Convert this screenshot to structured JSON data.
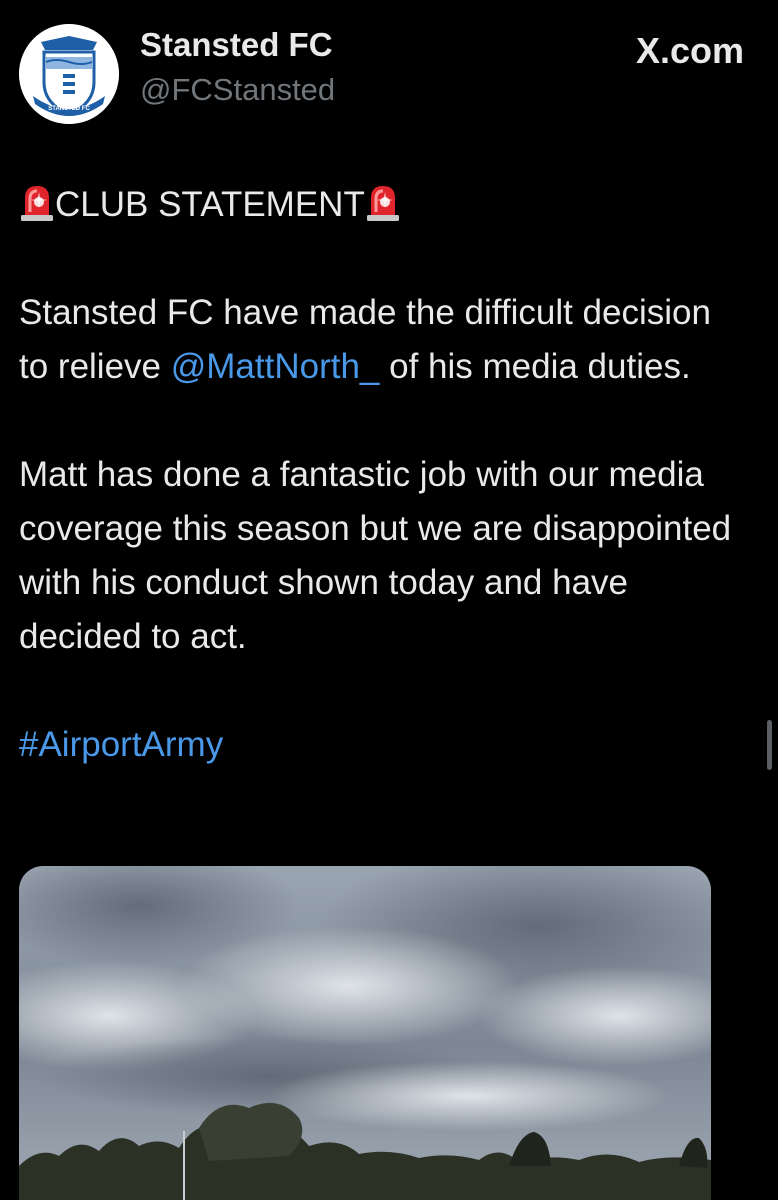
{
  "post": {
    "author": {
      "display_name": "Stansted FC",
      "handle": "@FCStansted",
      "avatar_text": "STANSTED FC"
    },
    "source_label": "X.com",
    "statement_heading": "CLUB STATEMENT",
    "paragraph1_before": "Stansted FC have made the difficult decision to relieve ",
    "mention": "@MattNorth_",
    "paragraph1_after": " of his media duties.",
    "paragraph2": "Matt has done a fantastic job with our media coverage this season but we are disappointed with his conduct shown today and have decided to act.",
    "hashtag": "#AirportArmy",
    "media": {
      "icon": "photo-of-cloudy-sky-over-trees"
    }
  },
  "colors": {
    "background": "#000000",
    "text": "#e7e9ea",
    "secondary_text": "#71767b",
    "link": "#4a98e8",
    "siren_red": "#e0242b"
  }
}
